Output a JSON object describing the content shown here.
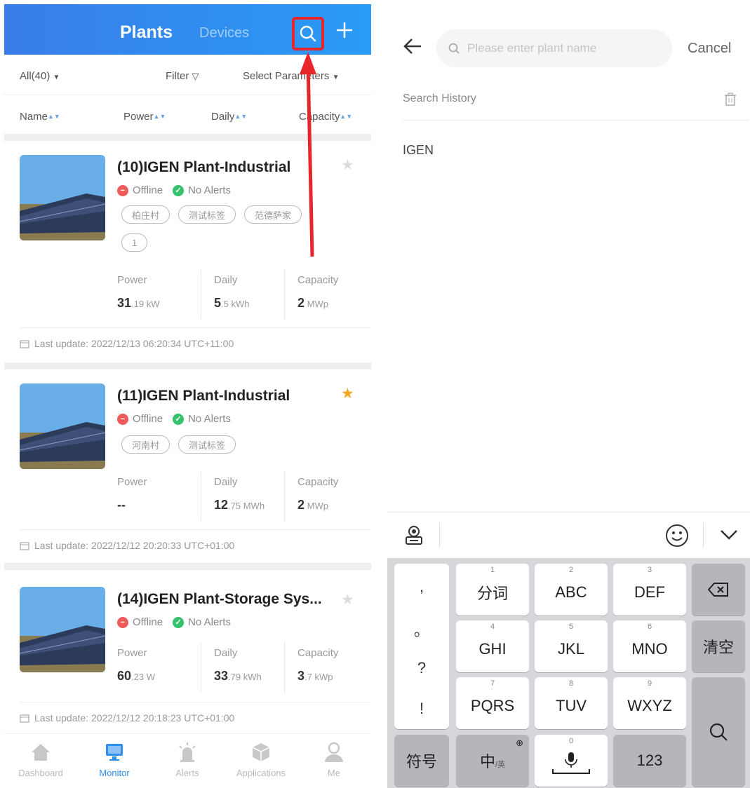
{
  "left": {
    "header": {
      "tab_active": "Plants",
      "tab_inactive": "Devices"
    },
    "filters": {
      "all": "All(40)",
      "filter": "Filter",
      "select_params": "Select Parameters"
    },
    "sort": {
      "name": "Name",
      "power": "Power",
      "daily": "Daily",
      "capacity": "Capacity"
    },
    "plants": [
      {
        "title": "(10)IGEN Plant-Industrial",
        "starred": false,
        "status": "Offline",
        "alerts": "No Alerts",
        "tags": [
          "柏庄村",
          "测试标签",
          "范德萨家"
        ],
        "tags2": [
          "1"
        ],
        "power_label": "Power",
        "power_value": "31",
        "power_unit": ".19 kW",
        "daily_label": "Daily",
        "daily_value": "5",
        "daily_unit": ".5 kWh",
        "capacity_label": "Capacity",
        "capacity_value": "2",
        "capacity_unit": " MWp",
        "last_update": "Last update: 2022/12/13 06:20:34 UTC+11:00"
      },
      {
        "title": "(11)IGEN Plant-Industrial",
        "starred": true,
        "status": "Offline",
        "alerts": "No Alerts",
        "tags": [
          "河南村",
          "测试标签"
        ],
        "power_label": "Power",
        "power_value": "--",
        "power_unit": "",
        "daily_label": "Daily",
        "daily_value": "12",
        "daily_unit": ".75 MWh",
        "capacity_label": "Capacity",
        "capacity_value": "2",
        "capacity_unit": " MWp",
        "last_update": "Last update: 2022/12/12 20:20:33 UTC+01:00"
      },
      {
        "title": "(14)IGEN Plant-Storage Sys...",
        "starred": false,
        "status": "Offline",
        "alerts": "No Alerts",
        "power_label": "Power",
        "power_value": "60",
        "power_unit": ".23 W",
        "daily_label": "Daily",
        "daily_value": "33",
        "daily_unit": ".79 kWh",
        "capacity_label": "Capacity",
        "capacity_value": "3",
        "capacity_unit": ".7 kWp",
        "last_update": "Last update: 2022/12/12 20:18:23 UTC+01:00"
      }
    ],
    "nav": [
      {
        "label": "Dashboard",
        "icon": "home-icon"
      },
      {
        "label": "Monitor",
        "icon": "monitor-icon",
        "active": true
      },
      {
        "label": "Alerts",
        "icon": "alert-siren-icon"
      },
      {
        "label": "Applications",
        "icon": "cube-icon"
      },
      {
        "label": "Me",
        "icon": "person-icon"
      }
    ]
  },
  "right": {
    "search": {
      "placeholder": "Please enter plant name",
      "value": ""
    },
    "cancel_label": "Cancel",
    "history_title": "Search History",
    "history_items": [
      "IGEN"
    ],
    "keyboard": {
      "punct": [
        ",",
        "。",
        "?",
        "!"
      ],
      "keys": [
        {
          "num": "1",
          "label": "分词"
        },
        {
          "num": "2",
          "label": "ABC"
        },
        {
          "num": "3",
          "label": "DEF"
        },
        {
          "num": "4",
          "label": "GHI"
        },
        {
          "num": "5",
          "label": "JKL"
        },
        {
          "num": "6",
          "label": "MNO"
        },
        {
          "num": "7",
          "label": "PQRS"
        },
        {
          "num": "8",
          "label": "TUV"
        },
        {
          "num": "9",
          "label": "WXYZ"
        }
      ],
      "clear_label": "清空",
      "symbols_label": "符号",
      "lang_label": "中",
      "lang_sub": "/英",
      "space_num": "0",
      "numbers_label": "123"
    }
  },
  "colors": {
    "brand_blue": "#2f8ff0",
    "highlight_red": "#e8262a",
    "offline_red": "#ef5b5b",
    "ok_green": "#34c36b",
    "star_orange": "#f5a623"
  }
}
